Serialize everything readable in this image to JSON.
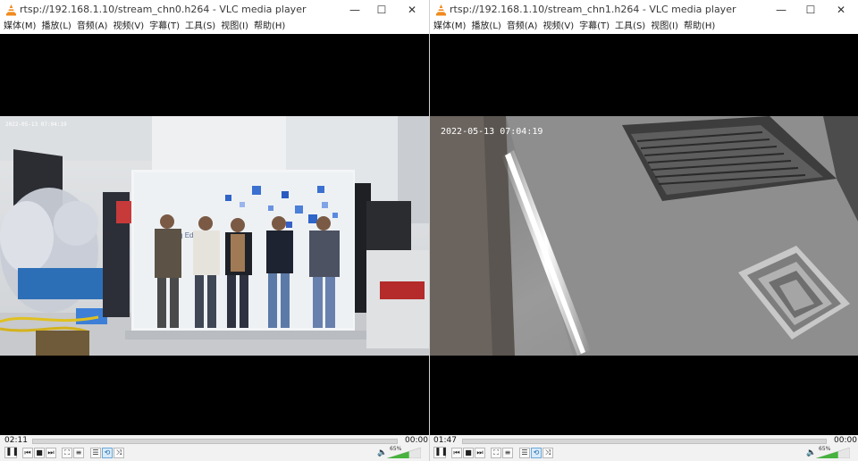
{
  "colors": {
    "vlc_orange": "#f08a1c",
    "volume_green": "#47b23e",
    "toggle_blue": "#1565a8"
  },
  "left": {
    "title": "rtsp://192.168.1.10/stream_chn0.h264 - VLC media player",
    "timestamp": "2022-05-13 07:04:19",
    "poster_text": "Leading Edge AI",
    "elapsed": "02:11",
    "duration": "00:00",
    "volume_label": "65%",
    "volume_fraction": 0.65
  },
  "right": {
    "title": "rtsp://192.168.1.10/stream_chn1.h264 - VLC media player",
    "timestamp": "2022-05-13 07:04:19",
    "elapsed": "01:47",
    "duration": "00:00",
    "volume_label": "65%",
    "volume_fraction": 0.65
  },
  "menu": [
    "媒体(M)",
    "播放(L)",
    "音频(A)",
    "视频(V)",
    "字幕(T)",
    "工具(S)",
    "视图(I)",
    "帮助(H)"
  ],
  "window_controls": {
    "minimize": "—",
    "maximize": "☐",
    "close": "✕"
  },
  "icons": {
    "pause": "❚❚",
    "prev": "⏮",
    "stop": "■",
    "next": "⏭",
    "fullscreen": "⛶",
    "extended": "≡",
    "playlist": "☰",
    "loop": "⟲",
    "shuffle": "⤨",
    "speaker": "🔈"
  }
}
